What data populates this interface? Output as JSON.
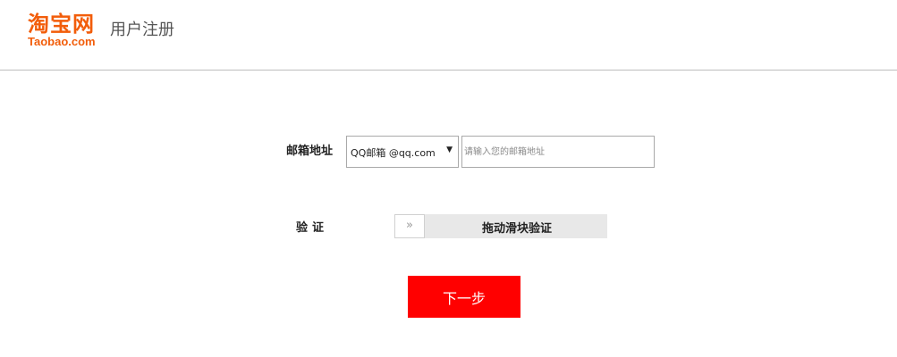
{
  "header": {
    "logo_cn": "淘宝网",
    "logo_en": "Taobao.com",
    "page_title": "用户注册",
    "brand_color": "#f25d0a"
  },
  "form": {
    "email_label": "邮箱地址",
    "email_provider_selected": "QQ邮箱 @qq.com",
    "email_placeholder": "请输入您的邮箱地址",
    "email_value": "",
    "verify_label": "验证",
    "slider_handle_glyph": "»",
    "slider_text": "拖动滑块验证",
    "next_label": "下一步",
    "button_color": "#ff0000"
  }
}
